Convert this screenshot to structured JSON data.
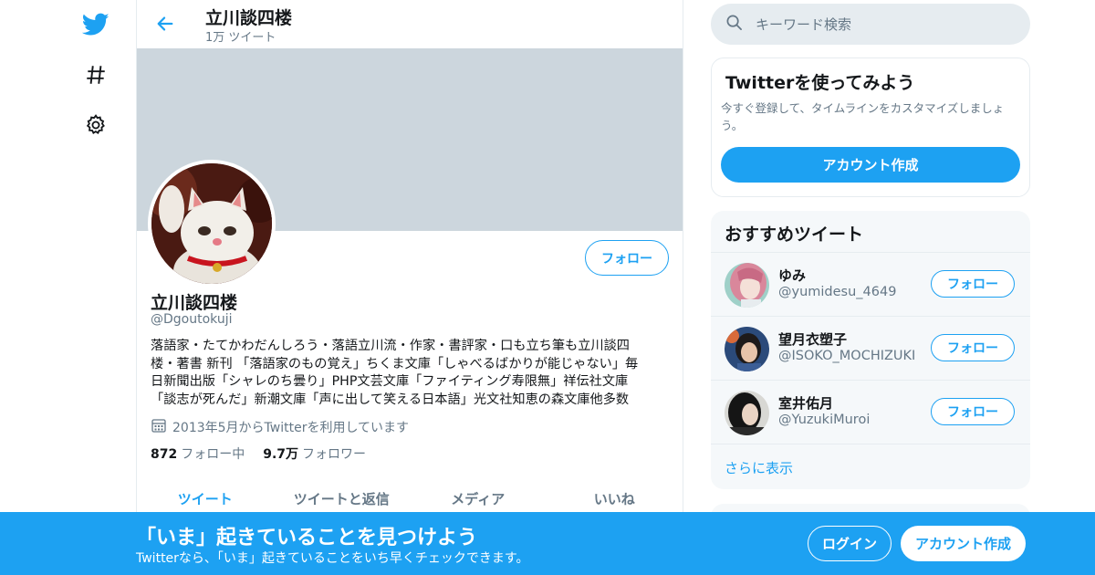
{
  "nav": {
    "icons": [
      "twitter-logo-icon",
      "hashtag-icon",
      "gear-icon"
    ]
  },
  "header": {
    "title": "立川談四楼",
    "tweet_count": "1万 ツイート"
  },
  "profile": {
    "name": "立川談四楼",
    "handle": "@Dgoutokuji",
    "follow_label": "フォロー",
    "bio_lines": [
      "落語家・たてかわだんしろう・落語立川流・作家・書評家・口も立ち筆も立川談四",
      "楼・著書 新刊 「落語家のもの覚え」ちくま文庫「しゃべるばかりが能じゃない」毎",
      "日新聞出版「シャレのち曇り」PHP文芸文庫「ファイティング寿限無」祥伝社文庫",
      "「談志が死んだ」新潮文庫「声に出して笑える日本語」光文社知恵の森文庫他多数"
    ],
    "joined": "2013年5月からTwitterを利用しています",
    "following_count": "872",
    "following_label": "フォロー中",
    "followers_count": "9.7万",
    "followers_label": "フォロワー"
  },
  "tabs": [
    {
      "label": "ツイート"
    },
    {
      "label": "ツイートと返信"
    },
    {
      "label": "メディア"
    },
    {
      "label": "いいね"
    }
  ],
  "search": {
    "placeholder": "キーワード検索"
  },
  "signup": {
    "title": "Twitterを使ってみよう",
    "desc": "今すぐ登録して、タイムラインをカスタマイズしましょう。",
    "button": "アカウント作成"
  },
  "recommended": {
    "title": "おすすめツイート",
    "items": [
      {
        "name": "ゆみ",
        "handle": "@yumidesu_4649",
        "follow": "フォロー"
      },
      {
        "name": "望月衣塑子",
        "handle": "@ISOKO_MOCHIZUKI",
        "follow": "フォロー"
      },
      {
        "name": "室井佑月",
        "handle": "@YuzukiMuroi",
        "follow": "フォロー"
      }
    ],
    "more": "さらに表示"
  },
  "bottombar": {
    "title": "「いま」起きていることを見つけよう",
    "subtitle": "Twitterなら、「いま」起きていることをいち早くチェックできます。",
    "login": "ログイン",
    "signup": "アカウント作成"
  },
  "colors": {
    "accent": "#1da1f2",
    "banner": "#ccd6dd",
    "secondary_text": "#657786"
  }
}
